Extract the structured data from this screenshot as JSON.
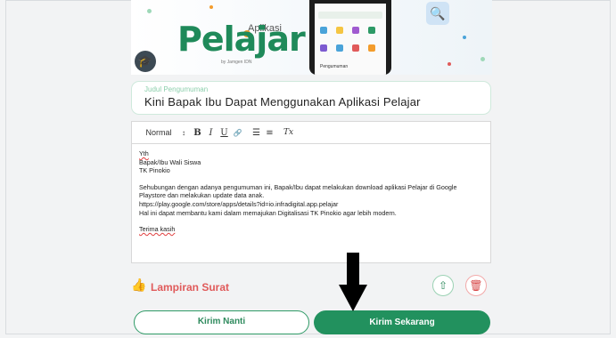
{
  "colors": {
    "brand_green": "#22915e",
    "light_green_border": "#cfe9dc",
    "label_green": "#8ccfac",
    "danger_red": "#e05a5a",
    "background": "#f2f3f4"
  },
  "banner": {
    "logo_text": "Pelajar",
    "logo_prefix": "Aplikasi",
    "logo_tagline": "by Jamgen IDN",
    "phone_section_label": "Pengumuman",
    "icons": [
      "graduation-hat-icon",
      "search-badge-icon"
    ]
  },
  "announcement": {
    "title_label": "Judul Pengumuman",
    "title_value": "Kini Bapak Ibu Dapat Menggunakan Aplikasi Pelajar"
  },
  "editor": {
    "toolbar": {
      "format_select": "Normal",
      "caret": "↕",
      "bold": "B",
      "italic": "I",
      "underline": "U",
      "link": "🔗",
      "ordered_list": "☰",
      "bullet_list": "≡",
      "clear_format": "Tx"
    },
    "greeting_1": "Yth",
    "greeting_2": "Bapak/Ibu Wali Siswa",
    "greeting_3": "TK Pinokio",
    "paragraph_1": "Sehubungan dengan adanya pengumuman ini, Bapak/Ibu dapat melakukan download aplikasi Pelajar di Google",
    "paragraph_2": "Playstore dan melakukan update data anak.",
    "paragraph_3": "https://play.google.com/store/apps/details?id=io.infradigital.app.pelajar",
    "paragraph_4": "Hal ini dapat membantu kami dalam memajukan Digitalisasi TK Pinokio agar lebih modern.",
    "closing": "Terima kasih"
  },
  "attachment": {
    "label": "Lampiran Surat",
    "icon": "thumbs-up-icon",
    "upload_icon": "upload-icon",
    "delete_icon": "trash-icon"
  },
  "actions": {
    "send_later": "Kirim Nanti",
    "send_now": "Kirim Sekarang"
  }
}
